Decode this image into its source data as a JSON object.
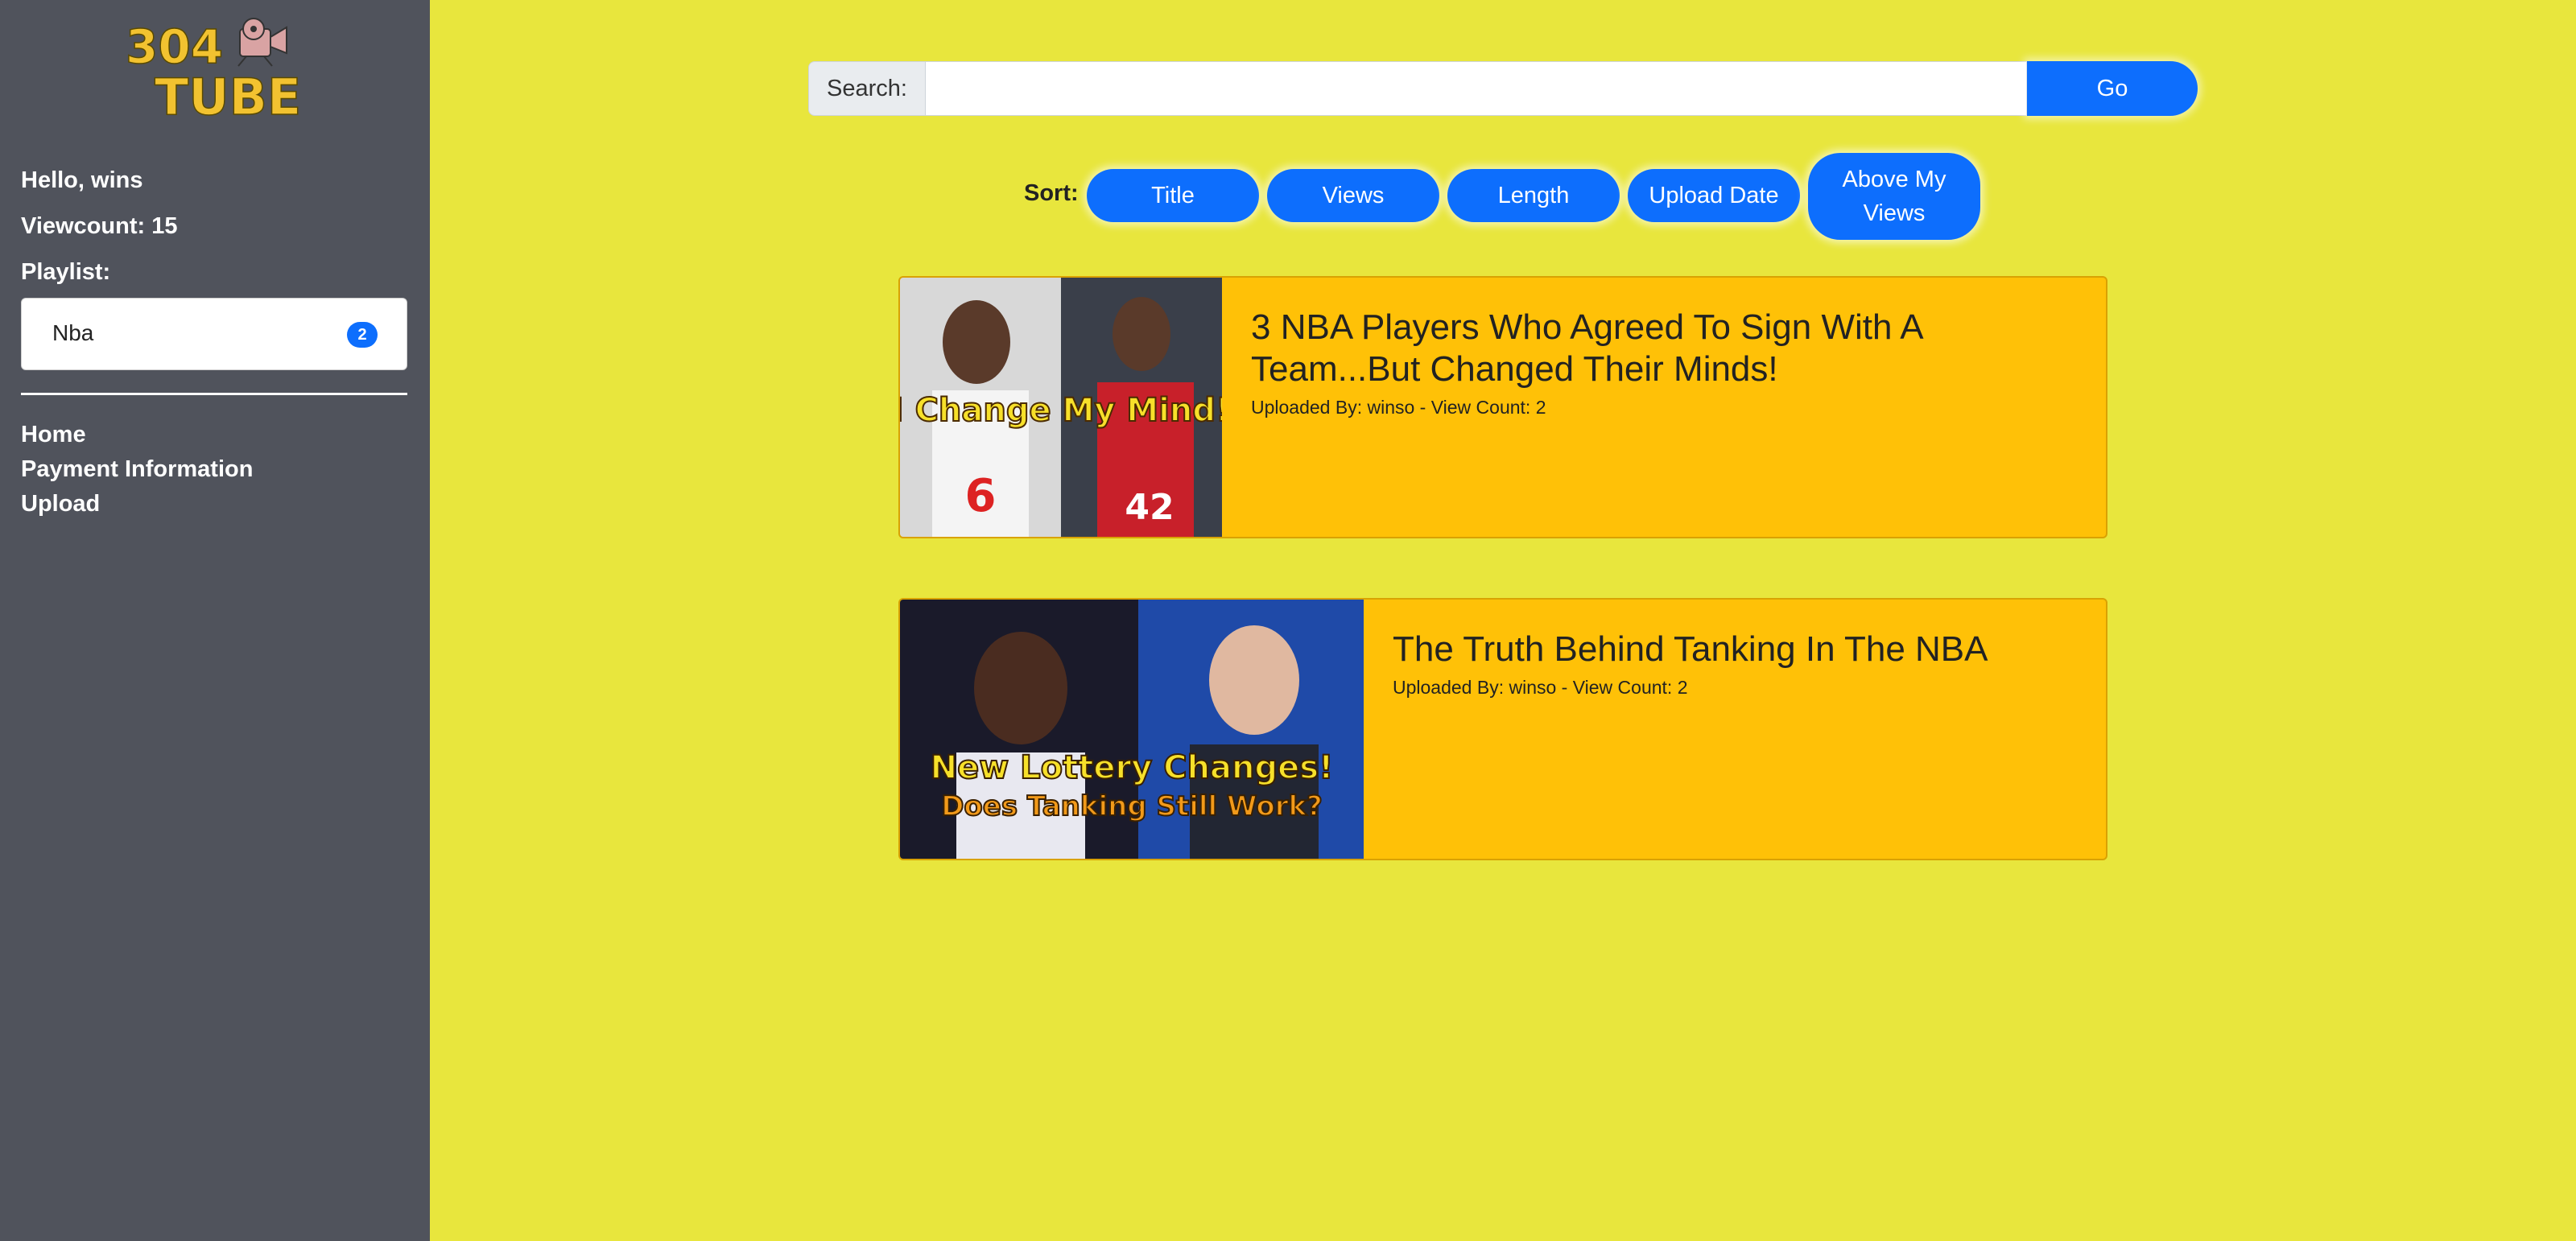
{
  "brand": {
    "logo_line1": "304",
    "logo_line2": "TUBE",
    "logo_icon": "movie-camera-icon",
    "logo_color": "#f2c230"
  },
  "sidebar": {
    "greeting": "Hello, wins",
    "viewcount": "Viewcount: 15",
    "playlist_label": "Playlist:",
    "playlist": [
      {
        "name": "Nba",
        "count": "2"
      }
    ],
    "nav": {
      "home": "Home",
      "payment": "Payment Information",
      "upload": "Upload"
    }
  },
  "search": {
    "label": "Search:",
    "value": "",
    "placeholder": "",
    "go_label": "Go"
  },
  "sort": {
    "label": "Sort:",
    "options": [
      "Title",
      "Views",
      "Length",
      "Upload Date",
      "Above My Views"
    ]
  },
  "videos": [
    {
      "title": "3 NBA Players Who Agreed To Sign With A Team...But Changed Their Minds!",
      "meta": "Uploaded By: winso - View Count: 2",
      "thumbnail_text": "I Change My Mind!",
      "thumbnail_icon": "video-thumbnail-image"
    },
    {
      "title": "The Truth Behind Tanking In The NBA",
      "meta": "Uploaded By: winso - View Count: 2",
      "thumbnail_text_1": "New Lottery Changes!",
      "thumbnail_text_2": "Does Tanking Still Work?",
      "thumbnail_icon": "video-thumbnail-image"
    }
  ],
  "colors": {
    "page_background": "#e8e63d",
    "sidebar_background": "#50535c",
    "accent": "#0d6efd",
    "card_background": "#ffc107"
  }
}
